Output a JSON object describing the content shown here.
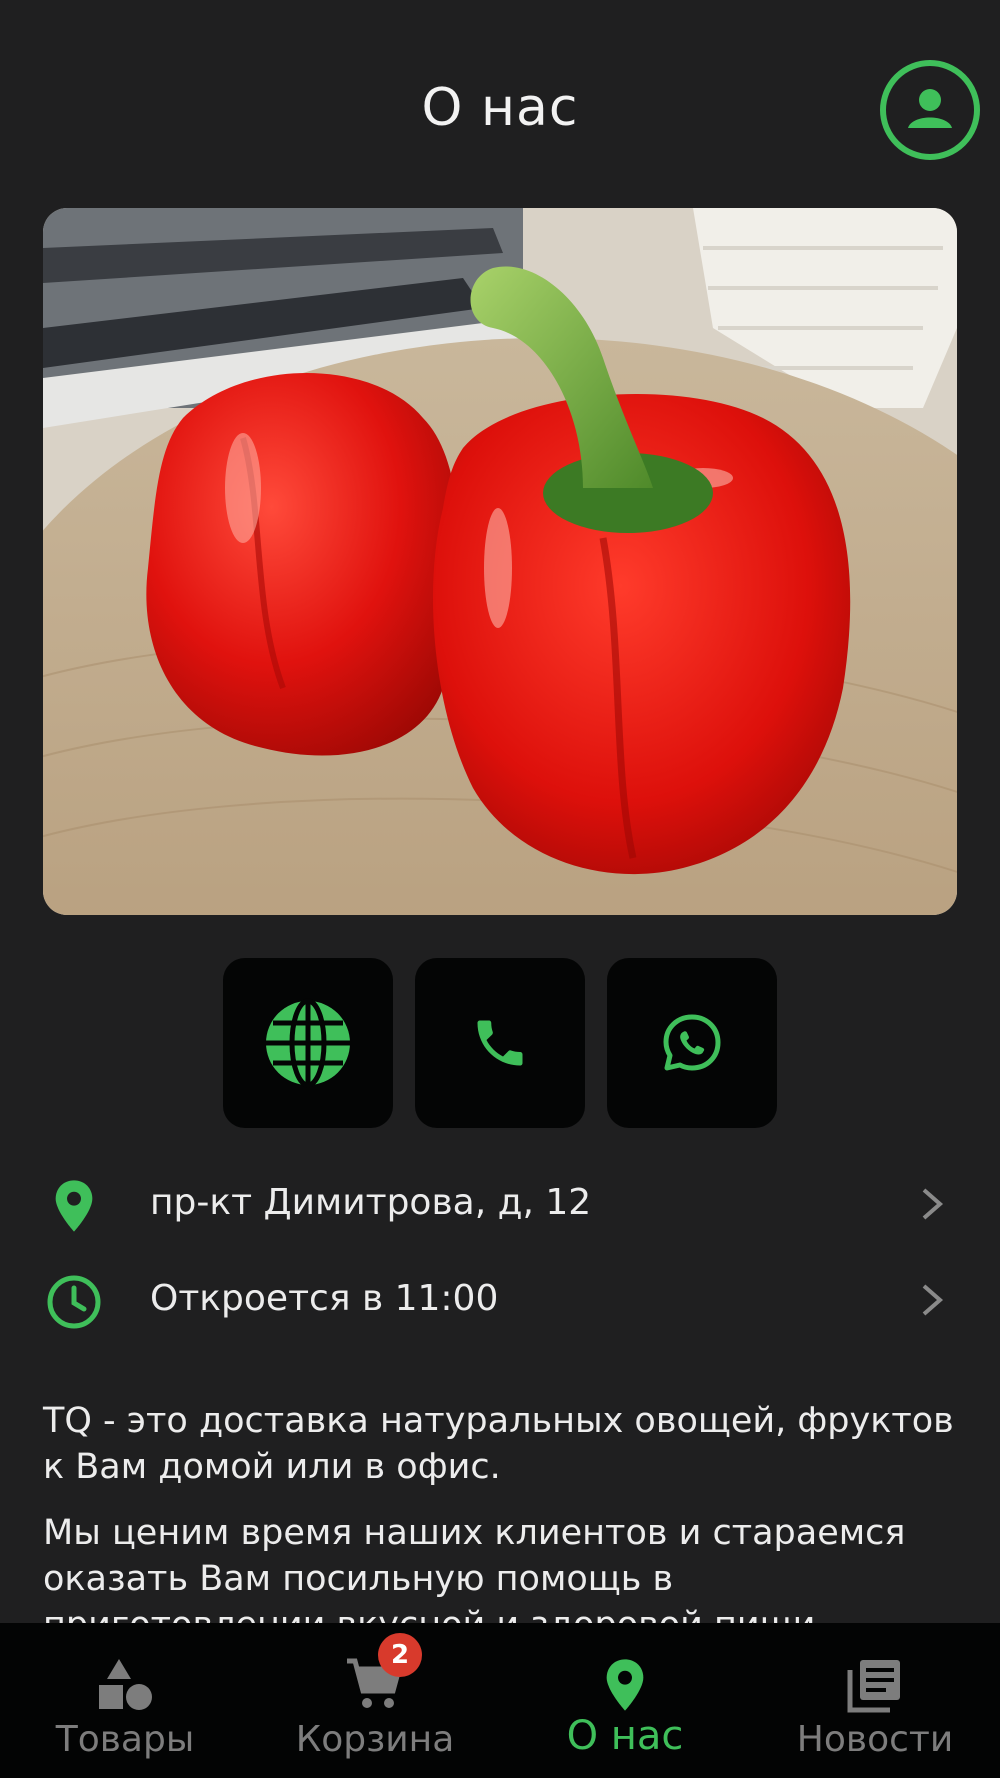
{
  "header": {
    "title": "О нас"
  },
  "icons": {
    "profile": "account-circle-icon",
    "website": "globe-icon",
    "phone": "phone-icon",
    "whatsapp": "whatsapp-icon",
    "location": "map-pin-icon",
    "hours": "clock-icon",
    "chevron": "chevron-right-icon"
  },
  "info": {
    "address": "пр-кт Димитрова, д, 12",
    "hours": "Откроется в 11:00"
  },
  "description": {
    "paragraph1": "ТQ - это доставка натуральных овощей, фруктов к Вам домой или в офис.",
    "paragraph2": "Мы ценим время наших клиентов и стараемся оказать Вам посильную помощь в приготовлении вкусной и здоровой пищи."
  },
  "bottom_nav": {
    "items": [
      {
        "label": "Товары",
        "icon": "shapes-icon",
        "active": false
      },
      {
        "label": "Корзина",
        "icon": "cart-icon",
        "active": false,
        "badge": "2"
      },
      {
        "label": "О нас",
        "icon": "map-pin-icon",
        "active": true
      },
      {
        "label": "Новости",
        "icon": "newspaper-icon",
        "active": false
      }
    ]
  },
  "colors": {
    "accent": "#3fbf5a",
    "background": "#1f1f20",
    "button_bg": "#040505",
    "badge": "#d83a2c",
    "inactive": "#7d7d7d"
  }
}
